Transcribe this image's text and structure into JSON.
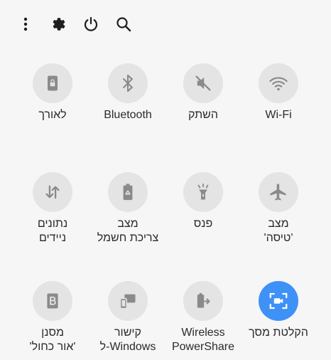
{
  "toolbar": {
    "more_icon": "more-vert-icon",
    "settings_icon": "gear-icon",
    "power_icon": "power-icon",
    "search_icon": "search-icon"
  },
  "colors": {
    "background": "#f6f6f6",
    "tile_inactive": "#e4e4e4",
    "icon_inactive": "#8a8a8a",
    "tile_active": "#3e91f7",
    "icon_active": "#ffffff",
    "text": "#2a2a2a"
  },
  "tiles": [
    {
      "id": "wifi",
      "icon": "wifi-icon",
      "active": false,
      "label_lines": [
        "Wi-Fi"
      ]
    },
    {
      "id": "mute",
      "icon": "mute-icon",
      "active": false,
      "label_lines": [
        "השתק"
      ]
    },
    {
      "id": "bluetooth",
      "icon": "bluetooth-icon",
      "active": false,
      "label_lines": [
        "Bluetooth"
      ]
    },
    {
      "id": "portrait",
      "icon": "portrait-lock-icon",
      "active": false,
      "label_lines": [
        "לאורך"
      ]
    },
    {
      "id": "airplane",
      "icon": "airplane-icon",
      "active": false,
      "label_lines": [
        "מצב",
        "'טיסה'"
      ]
    },
    {
      "id": "flashlight",
      "icon": "flashlight-icon",
      "active": false,
      "label_lines": [
        "פנס"
      ]
    },
    {
      "id": "power-saving",
      "icon": "battery-recycle-icon",
      "active": false,
      "label_lines": [
        "מצב",
        "צריכת חשמל"
      ]
    },
    {
      "id": "mobile-data",
      "icon": "data-arrows-icon",
      "active": false,
      "label_lines": [
        "נתונים",
        "ניידים"
      ]
    },
    {
      "id": "screen-recorder",
      "icon": "screen-record-icon",
      "active": true,
      "label_lines": [
        "הקלטת מסך"
      ]
    },
    {
      "id": "wireless-powershare",
      "icon": "powershare-icon",
      "active": false,
      "label_lines": [
        "Wireless",
        "PowerShare"
      ]
    },
    {
      "id": "link-to-windows",
      "icon": "link-windows-icon",
      "active": false,
      "label_lines": [
        "קישור",
        "ל-Windows"
      ]
    },
    {
      "id": "blue-light",
      "icon": "blue-light-filter-icon",
      "active": false,
      "label_lines": [
        "מסנן",
        "'אור כחול'"
      ]
    }
  ]
}
